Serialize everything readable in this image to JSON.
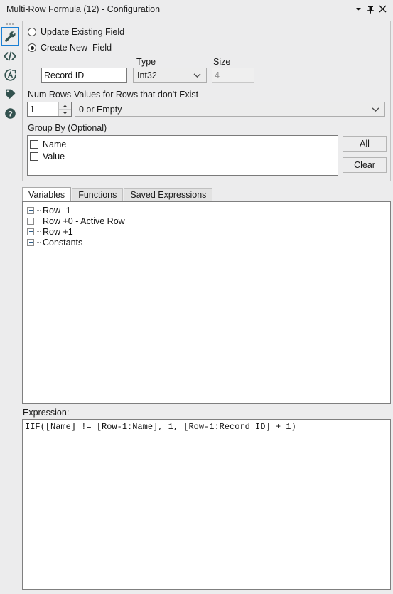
{
  "window": {
    "title": "Multi-Row Formula (12) - Configuration",
    "controls": [
      {
        "name": "dropdown-arrow",
        "icon": "chevron-down-icon"
      },
      {
        "name": "pin",
        "icon": "pin-icon"
      },
      {
        "name": "close",
        "icon": "close-icon"
      }
    ]
  },
  "rail": {
    "items": [
      {
        "name": "configuration",
        "icon": "wrench-icon",
        "selected": true
      },
      {
        "name": "xml-view",
        "icon": "code-icon",
        "selected": false
      },
      {
        "name": "annotation",
        "icon": "circle-a-icon",
        "selected": false
      },
      {
        "name": "tag",
        "icon": "tag-icon",
        "selected": false
      },
      {
        "name": "help",
        "icon": "question-mark-icon",
        "selected": false
      }
    ]
  },
  "config": {
    "update_existing_label": "Update Existing Field",
    "update_existing_checked": false,
    "create_new_label": "Create New  Field",
    "create_new_checked": true,
    "field_name_value": "Record ID",
    "type_label": "Type",
    "type_value": "Int32",
    "size_label": "Size",
    "size_value": "4",
    "size_disabled": true,
    "num_rows_label": "Num Rows",
    "num_rows_value": "1",
    "values_rows_label": "Values for Rows that don't Exist",
    "values_rows_value": "0 or Empty",
    "group_by_label": "Group By (Optional)",
    "group_by_items": [
      {
        "label": "Name",
        "checked": false
      },
      {
        "label": "Value",
        "checked": false
      }
    ],
    "all_button": "All",
    "clear_button": "Clear"
  },
  "tabs": [
    {
      "label": "Variables",
      "active": true
    },
    {
      "label": "Functions",
      "active": false
    },
    {
      "label": "Saved Expressions",
      "active": false
    }
  ],
  "tree": {
    "items": [
      {
        "label": "Row -1",
        "expanded": false
      },
      {
        "label": "Row +0 - Active Row",
        "expanded": false
      },
      {
        "label": "Row +1",
        "expanded": false
      },
      {
        "label": "Constants",
        "expanded": false
      }
    ]
  },
  "expression": {
    "label": "Expression:",
    "value": "IIF([Name] != [Row-1:Name], 1, [Row-1:Record ID] + 1)"
  },
  "colors": {
    "window_bg": "#ececed",
    "panel_bg": "#ffffff",
    "accent_selection": "#1a7fd4",
    "icon_color": "#33524f"
  }
}
